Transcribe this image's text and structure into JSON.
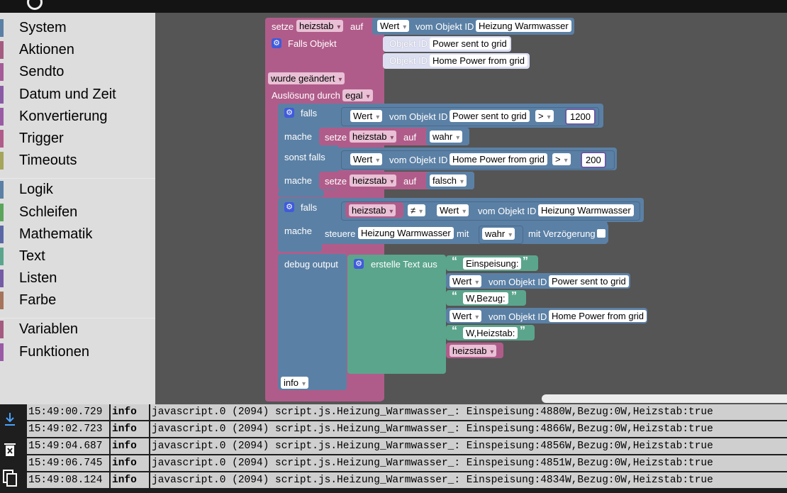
{
  "toolbox": {
    "group1": [
      "System",
      "Aktionen",
      "Sendto",
      "Datum und Zeit",
      "Konvertierung",
      "Trigger",
      "Timeouts"
    ],
    "group2": [
      "Logik",
      "Schleifen",
      "Mathematik",
      "Text",
      "Listen",
      "Farbe"
    ],
    "group3": [
      "Variablen",
      "Funktionen"
    ]
  },
  "colors": {
    "variable_block": "#b05c8a",
    "logic_block": "#5b80a5",
    "text_block": "#5ba58c",
    "workspace": "#555555",
    "toolbox": "#dddddd"
  },
  "blocks": {
    "setze": "setze",
    "var_name": "heizstab",
    "auf": "auf",
    "wert": "Wert",
    "vom_objekt_id": "vom Objekt ID",
    "obj_heizung": "Heizung Warmwasser",
    "falls_objekt": "Falls Objekt",
    "objekt_id": "Objekt ID",
    "obj_power_grid": "Power sent to grid",
    "obj_home_power": "Home Power from grid",
    "wurde_geaendert": "wurde geändert",
    "ausloesung_durch": "Auslösung durch",
    "egal": "egal",
    "falls": "falls",
    "mache": "mache",
    "sonst_falls": "sonst falls",
    "op_gt": ">",
    "op_neq": "≠",
    "num_1200": "1200",
    "num_200": "200",
    "wahr": "wahr",
    "falsch": "falsch",
    "steuere": "steuere",
    "mit": "mit",
    "mit_verzoegerung": "mit Verzögerung",
    "debug_output": "debug output",
    "erstelle_text_aus": "erstelle Text aus",
    "text_einspeisung": "Einspeisung:",
    "text_bezug": "W,Bezug:",
    "text_heizstab": "W,Heizstab:",
    "info": "info"
  },
  "log": {
    "rows": [
      {
        "time": "15:49:00.729",
        "level": "info",
        "message": "javascript.0 (2094) script.js.Heizung_Warmwasser_: Einspeisung:4880W,Bezug:0W,Heizstab:true"
      },
      {
        "time": "15:49:02.723",
        "level": "info",
        "message": "javascript.0 (2094) script.js.Heizung_Warmwasser_: Einspeisung:4866W,Bezug:0W,Heizstab:true"
      },
      {
        "time": "15:49:04.687",
        "level": "info",
        "message": "javascript.0 (2094) script.js.Heizung_Warmwasser_: Einspeisung:4856W,Bezug:0W,Heizstab:true"
      },
      {
        "time": "15:49:06.745",
        "level": "info",
        "message": "javascript.0 (2094) script.js.Heizung_Warmwasser_: Einspeisung:4851W,Bezug:0W,Heizstab:true"
      },
      {
        "time": "15:49:08.124",
        "level": "info",
        "message": "javascript.0 (2094) script.js.Heizung_Warmwasser_: Einspeisung:4834W,Bezug:0W,Heizstab:true"
      }
    ],
    "icons": [
      "download-icon",
      "delete-icon",
      "copy-icon"
    ]
  }
}
